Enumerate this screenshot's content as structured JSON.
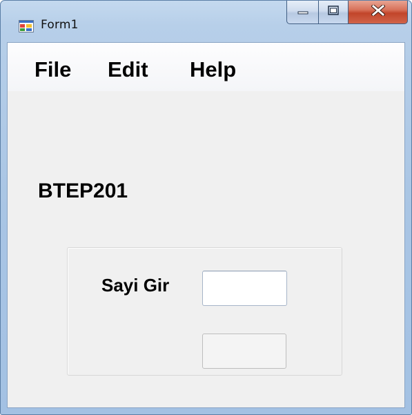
{
  "window": {
    "title": "Form1",
    "app_icon": "winforms-app-icon",
    "controls": {
      "minimize_icon": "minimize-icon",
      "maximize_icon": "maximize-icon",
      "close_icon": "close-icon"
    },
    "colors": {
      "frame": "#a9c5e4",
      "client_background": "#f0f0f0",
      "close_button": "#c2452a"
    }
  },
  "menu": {
    "items": [
      {
        "label": "File"
      },
      {
        "label": "Edit"
      },
      {
        "label": "Help"
      }
    ]
  },
  "main": {
    "heading": "BTEP201",
    "panel": {
      "field_label": "Sayi Gir",
      "input_value": "",
      "button_label": ""
    }
  }
}
